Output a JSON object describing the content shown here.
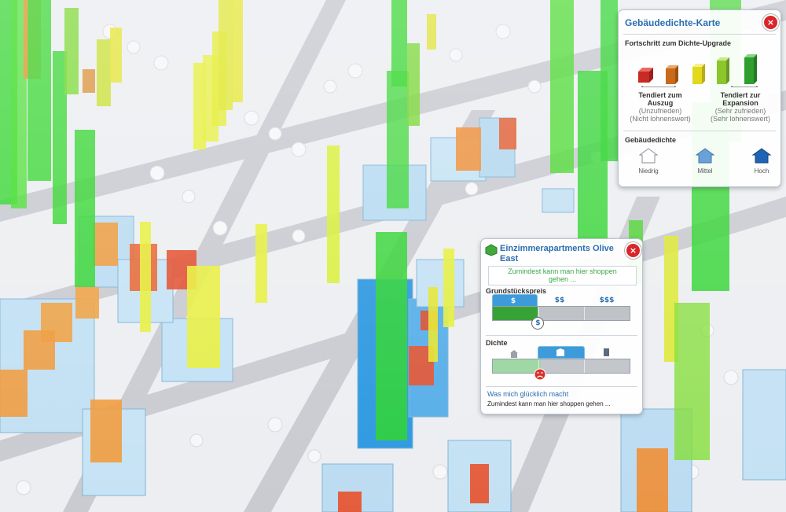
{
  "legend": {
    "title": "Gebäudedichte-Karte",
    "close": "×",
    "progress_heading": "Fortschritt zum Dichte-Upgrade",
    "levels": [
      {
        "color": "#d8342b",
        "icon": "cube-red-icon"
      },
      {
        "color": "#d87a1e",
        "icon": "cube-orange-icon"
      },
      {
        "color": "#e6e01f",
        "icon": "cube-yellow-icon"
      },
      {
        "color": "#97d62c",
        "icon": "cube-lime-icon"
      },
      {
        "color": "#3fbf38",
        "icon": "cube-green-icon"
      }
    ],
    "left_label": {
      "line1": "Tendiert zum",
      "line2": "Auszug",
      "line3": "(Unzufrieden)",
      "line4": "(Nicht lohnenswert)"
    },
    "right_label": {
      "line1": "Tendiert zur",
      "line2": "Expansion",
      "line3": "(Sehr zufrieden)",
      "line4": "(Sehr lohnenswert)"
    },
    "density_heading": "Gebäudedichte",
    "density": [
      {
        "label": "Niedrig",
        "color": "#ffffff",
        "icon": "house-low-icon"
      },
      {
        "label": "Mittel",
        "color": "#6aa2d8",
        "icon": "house-medium-icon"
      },
      {
        "label": "Hoch",
        "color": "#1f63b5",
        "icon": "house-high-icon"
      }
    ]
  },
  "info": {
    "name": "Einzimmerapartments Olive East",
    "name_line1": "Einzimmerapartments Olive",
    "name_line2": "East",
    "close": "×",
    "quote_line1": "Zumindest kann man hier shoppen",
    "quote_line2": "gehen ...",
    "land_value_heading": "Grundstückspreis",
    "land_value_progress": 0.33,
    "land_value_marker": "$",
    "land_value_tiers": [
      "$",
      "$$",
      "$$$"
    ],
    "density_heading": "Dichte",
    "density_progress": 0.35,
    "happy_heading": "Was mich glücklich macht",
    "happy_text": "Zumindest kann man hier shoppen gehen ..."
  }
}
